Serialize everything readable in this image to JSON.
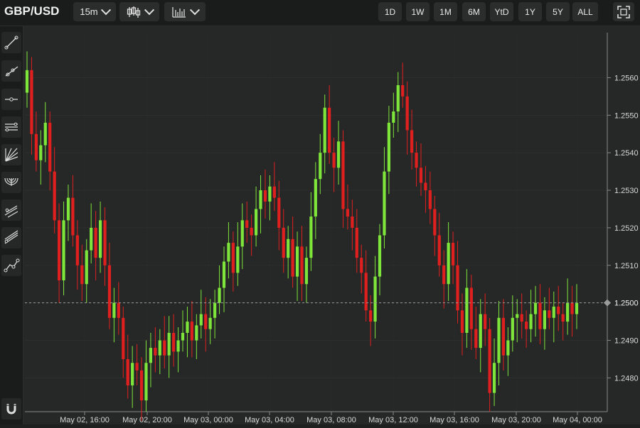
{
  "header": {
    "symbol": "GBP/USD",
    "interval": "15m",
    "chart_type_icon": "candlestick-icon",
    "indicators_icon": "indicators-icon",
    "ranges": [
      "1D",
      "1W",
      "1M",
      "6M",
      "YtD",
      "1Y",
      "5Y",
      "ALL"
    ],
    "fullscreen_icon": "fullscreen-icon"
  },
  "toolbar": {
    "tools": [
      "trend-line-icon",
      "ray-icon",
      "horizontal-line-icon",
      "parallel-channel-icon",
      "fib-fan-icon",
      "fib-arc-icon",
      "pitchfork-icon",
      "regression-icon",
      "path-icon"
    ],
    "magnet_icon": "magnet-icon"
  },
  "colors": {
    "up": "#7ee63a",
    "down": "#e0201f",
    "background": "#262727",
    "grid": "#3a3b3b",
    "price_line": "#9a9a9a"
  },
  "chart_data": {
    "type": "candlestick",
    "title": "",
    "xlabel": "",
    "ylabel": "",
    "ylim": [
      1.2471,
      1.2572
    ],
    "y_ticks": [
      "1.2480",
      "1.2490",
      "1.2500",
      "1.2510",
      "1.2520",
      "1.2530",
      "1.2540",
      "1.2550",
      "1.2560"
    ],
    "x_ticks": [
      "May 02, 16:00",
      "May 02, 20:00",
      "May 03, 00:00",
      "May 03, 04:00",
      "May 03, 08:00",
      "May 03, 12:00",
      "May 03, 16:00",
      "May 03, 20:00",
      "May 04, 00:00"
    ],
    "last_price": "1.2500",
    "grid": true,
    "close": [
      1.2562,
      1.2545,
      1.2538,
      1.2542,
      1.2548,
      1.2535,
      1.2522,
      1.2506,
      1.2522,
      1.2528,
      1.2518,
      1.251,
      1.2505,
      1.2514,
      1.252,
      1.2512,
      1.2522,
      1.251,
      1.2496,
      1.25,
      1.2496,
      1.2485,
      1.2478,
      1.2484,
      1.2482,
      1.2474,
      1.2484,
      1.2488,
      1.2486,
      1.249,
      1.2486,
      1.2492,
      1.2487,
      1.249,
      1.2492,
      1.2495,
      1.249,
      1.2494,
      1.2497,
      1.2493,
      1.2496,
      1.25,
      1.2504,
      1.2511,
      1.2516,
      1.2508,
      1.2515,
      1.2522,
      1.252,
      1.2518,
      1.2525,
      1.253,
      1.2527,
      1.2531,
      1.2528,
      1.252,
      1.2512,
      1.2517,
      1.2507,
      1.2515,
      1.2505,
      1.2512,
      1.2523,
      1.2533,
      1.254,
      1.2552,
      1.254,
      1.2536,
      1.2543,
      1.2525,
      1.2523,
      1.252,
      1.2512,
      1.2508,
      1.2498,
      1.2495,
      1.2507,
      1.2518,
      1.2535,
      1.2548,
      1.2551,
      1.2558,
      1.2555,
      1.2546,
      1.254,
      1.2536,
      1.2532,
      1.253,
      1.2525,
      1.2518,
      1.251,
      1.2505,
      1.2516,
      1.251,
      1.2498,
      1.2492,
      1.2504,
      1.2493,
      1.2488,
      1.2497,
      1.2493,
      1.2476,
      1.2484,
      1.2496,
      1.2486,
      1.249,
      1.2496,
      1.2497,
      1.2495,
      1.2493,
      1.2497,
      1.25,
      1.2493,
      1.2498,
      1.2496,
      1.2499,
      1.2497,
      1.2495,
      1.25,
      1.2497,
      1.25
    ]
  }
}
